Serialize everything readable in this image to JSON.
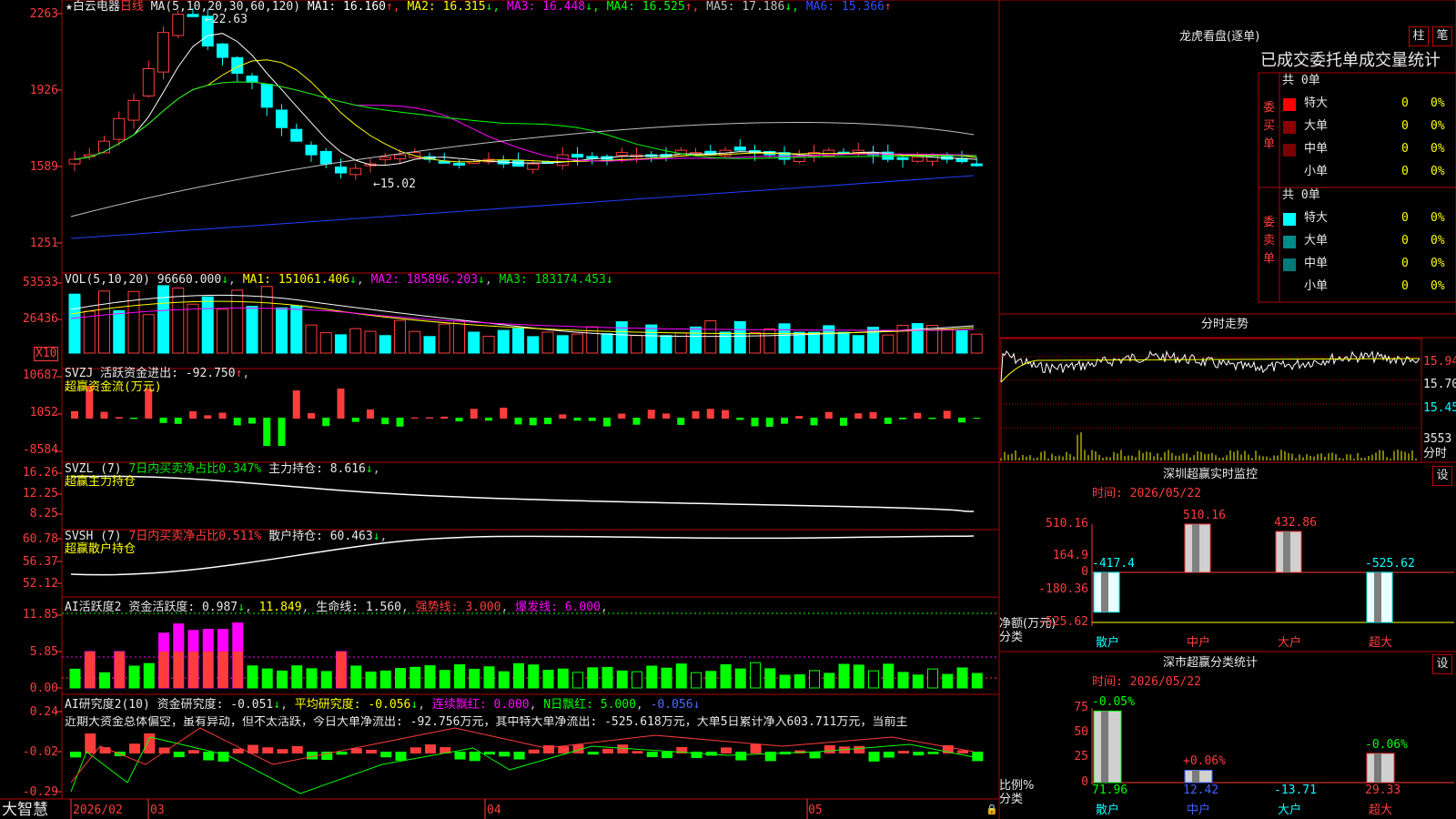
{
  "stock": {
    "name": "★白云电器",
    "period": "日线"
  },
  "price_axis": [
    "2263",
    "1926",
    "1589",
    "1251"
  ],
  "ma_legend": {
    "label": "MA(5,10,20,30,60,120)",
    "items": [
      {
        "text": "MA1: 16.160",
        "arrow": "↑",
        "color": "#ffffff"
      },
      {
        "text": "MA2: 16.315",
        "arrow": "↓",
        "color": "#ffff00"
      },
      {
        "text": "MA3: 16.448",
        "arrow": "↓",
        "color": "#ff00ff"
      },
      {
        "text": "MA4: 16.525",
        "arrow": "↑",
        "color": "#00ff00"
      },
      {
        "text": "MA5: 17.186",
        "arrow": "↓",
        "color": "#c0c0c0"
      },
      {
        "text": "MA6: 15.366",
        "arrow": "↑",
        "color": "#3050ff"
      }
    ]
  },
  "price_notes": {
    "high": "22.63",
    "low": "15.02"
  },
  "vol": {
    "axis": [
      "53533",
      "26436"
    ],
    "unit": "X10",
    "label": "VOL(5,10,20)",
    "val": "96660.000",
    "ma1": "MA1: 151061.406",
    "ma2": "MA2: 185896.203",
    "ma3": "MA3: 183174.453"
  },
  "svzj": {
    "axis": [
      "10687",
      "1052",
      "-8584"
    ],
    "label": "SVZJ",
    "desc": "活跃资金进出: -92.750",
    "title": "超赢资金流(万元)"
  },
  "svzl": {
    "axis": [
      "16.26",
      "12.25",
      "8.25"
    ],
    "label": "SVZL (7)",
    "desc": "7日内买卖净占比0.347%",
    "main": "主力持仓: 8.616",
    "title": "超赢主力持仓"
  },
  "svsh": {
    "axis": [
      "60.78",
      "56.37",
      "52.12"
    ],
    "label": "SVSH (7)",
    "desc": "7日内买卖净占比0.511%",
    "main": "散户持仓: 60.463",
    "title": "超赢散户持仓"
  },
  "ai1": {
    "axis": [
      "11.85",
      "5.85",
      "0.00"
    ],
    "label": "AI活跃度2",
    "a": "资金活跃度: 0.987",
    "b": "11.849",
    "c": "生命线: 1.560",
    "d": "强势线: 3.000",
    "e": "爆发线: 6.000"
  },
  "ai2": {
    "axis": [
      "0.24",
      "-0.02",
      "-0.29"
    ],
    "label": "AI研究度2(10)",
    "a": "资金研究度: -0.051",
    "b": "平均研究度: -0.056",
    "c": "连续飘红: 0.000",
    "d": "N日飘红: 5.000",
    "e": "-0.056",
    "comment": "近期大资金总体偏空，虽有异动，但不太活跃，今日大单净流出: -92.756万元，其中特大单净流出: -525.618万元，大单5日累计净入603.711万元，当前主"
  },
  "date_axis": {
    "brand": "大智慧",
    "labels": [
      "2026/02",
      "03",
      "04",
      "05"
    ]
  },
  "lhb": {
    "title": "龙虎看盘(逐单)",
    "tabs": [
      "柱",
      "笔"
    ],
    "sub": "已成交委托单成交量统计",
    "buy": {
      "side": "委买单",
      "total": "共 0单",
      "rows": [
        {
          "label": "特大",
          "v": "0",
          "p": "0%",
          "color": "#ff0000"
        },
        {
          "label": "大单",
          "v": "0",
          "p": "0%",
          "color": "#8b0000"
        },
        {
          "label": "中单",
          "v": "0",
          "p": "0%",
          "color": "#7a0000"
        },
        {
          "label": "小单",
          "v": "0",
          "p": "0%",
          "color": "#000000"
        }
      ]
    },
    "sell": {
      "side": "委卖单",
      "total": "共 0单",
      "rows": [
        {
          "label": "特大",
          "v": "0",
          "p": "0%",
          "color": "#00ffff"
        },
        {
          "label": "大单",
          "v": "0",
          "p": "0%",
          "color": "#008b8b"
        },
        {
          "label": "中单",
          "v": "0",
          "p": "0%",
          "color": "#007878"
        },
        {
          "label": "小单",
          "v": "0",
          "p": "0%",
          "color": "#000000"
        }
      ]
    }
  },
  "intraday": {
    "title": "分时走势",
    "axis": [
      "15.94",
      "15.70",
      "15.45"
    ],
    "vol_top": "3553",
    "vol_unit": "分时"
  },
  "sz_monitor": {
    "title": "深圳超赢实时监控",
    "btn": "设",
    "time": "时间: 2026/05/22",
    "axis": [
      "510.16",
      "164.9",
      "0",
      "-180.36",
      "-525.62"
    ],
    "ylabel1": "净额(万元)",
    "ylabel2": "分类",
    "chart_data": {
      "type": "bar",
      "categories": [
        "散户",
        "中户",
        "大户",
        "超大"
      ],
      "values": [
        -417.4,
        510.16,
        432.86,
        -525.62
      ],
      "ylim": [
        -525.62,
        510.16
      ]
    }
  },
  "sz_class": {
    "title": "深市超赢分类统计",
    "btn": "设",
    "time": "时间: 2026/05/22",
    "axis": [
      "75",
      "50",
      "25",
      "0"
    ],
    "ylabel1": "比例%",
    "ylabel2": "分类",
    "chart_data": {
      "type": "bar",
      "categories": [
        "散户",
        "中户",
        "大户",
        "超大"
      ],
      "values": [
        71.96,
        12.42,
        -13.71,
        29.33
      ],
      "changes": [
        "-0.05%",
        "+0.06%",
        "",
        "-0.06%"
      ],
      "ylim": [
        0,
        75
      ]
    }
  }
}
